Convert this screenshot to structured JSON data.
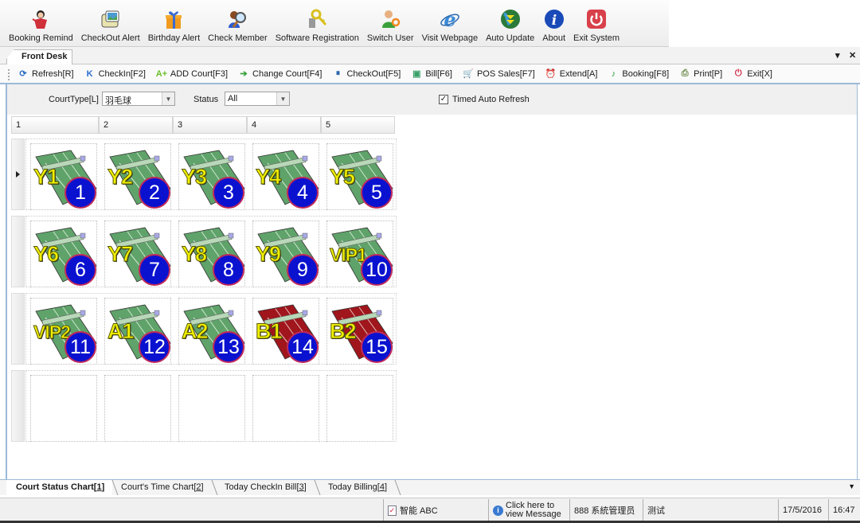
{
  "topbar": [
    {
      "label": "Booking Remind",
      "icon": "booking-remind-icon"
    },
    {
      "label": "CheckOut Alert",
      "icon": "checkout-alert-icon"
    },
    {
      "label": "Birthday Alert",
      "icon": "gift-icon"
    },
    {
      "label": "Check Member",
      "icon": "member-search-icon"
    },
    {
      "label": "Software Registration",
      "icon": "keys-icon"
    },
    {
      "label": "Switch User",
      "icon": "switch-user-icon"
    },
    {
      "label": "Visit Webpage",
      "icon": "browser-icon"
    },
    {
      "label": "Auto Update",
      "icon": "update-globe-icon"
    },
    {
      "label": "About",
      "icon": "info-icon"
    },
    {
      "label": "Exit System",
      "icon": "power-icon"
    }
  ],
  "doc_tab": {
    "label": "Front Desk"
  },
  "toolbar": [
    {
      "label": "Refresh[R]",
      "icon": "refresh-icon",
      "color": "#2b6cc4",
      "glyph": "⟳"
    },
    {
      "label": "CheckIn[F2]",
      "icon": "checkin-icon",
      "color": "#2a6fd0",
      "glyph": "K"
    },
    {
      "label": "ADD Court[F3]",
      "icon": "add-court-icon",
      "color": "#6cbf2a",
      "glyph": "A+"
    },
    {
      "label": "Change Court[F4]",
      "icon": "change-court-icon",
      "color": "#3aa23a",
      "glyph": "➔"
    },
    {
      "label": "CheckOut[F5]",
      "icon": "checkout-icon",
      "color": "#1d5fa8",
      "glyph": "⏸"
    },
    {
      "label": "Bill[F6]",
      "icon": "bill-icon",
      "color": "#3aa06a",
      "glyph": "▣"
    },
    {
      "label": "POS Sales[F7]",
      "icon": "cart-icon",
      "color": "#e05a8a",
      "glyph": "🛒"
    },
    {
      "label": "Extend[A]",
      "icon": "alarm-clock-icon",
      "color": "#222",
      "glyph": "⏰"
    },
    {
      "label": "Booking[F8]",
      "icon": "booking-icon",
      "color": "#2a9a3a",
      "glyph": "♪"
    },
    {
      "label": "Print[P]",
      "icon": "print-icon",
      "color": "#6a8a4a",
      "glyph": "⎙"
    },
    {
      "label": "Exit[X]",
      "icon": "exit-icon",
      "color": "#d0304a",
      "glyph": "⏻"
    }
  ],
  "filters": {
    "court_type_label": "CourtType[L]",
    "court_type_value": "羽毛球",
    "status_label": "Status",
    "status_value": "All",
    "auto_refresh_label": "Timed Auto Refresh",
    "auto_refresh_checked": true
  },
  "grid": {
    "columns": [
      "1",
      "2",
      "3",
      "4",
      "5"
    ],
    "rows": [
      [
        {
          "name": "Y1",
          "num": "1",
          "type": "green"
        },
        {
          "name": "Y2",
          "num": "2",
          "type": "green"
        },
        {
          "name": "Y3",
          "num": "3",
          "type": "green"
        },
        {
          "name": "Y4",
          "num": "4",
          "type": "green"
        },
        {
          "name": "Y5",
          "num": "5",
          "type": "green"
        }
      ],
      [
        {
          "name": "Y6",
          "num": "6",
          "type": "green"
        },
        {
          "name": "Y7",
          "num": "7",
          "type": "green"
        },
        {
          "name": "Y8",
          "num": "8",
          "type": "green"
        },
        {
          "name": "Y9",
          "num": "9",
          "type": "green"
        },
        {
          "name": "VIP1",
          "num": "10",
          "type": "green"
        }
      ],
      [
        {
          "name": "VIP2",
          "num": "11",
          "type": "green"
        },
        {
          "name": "A1",
          "num": "12",
          "type": "green"
        },
        {
          "name": "A2",
          "num": "13",
          "type": "green"
        },
        {
          "name": "B1",
          "num": "14",
          "type": "red"
        },
        {
          "name": "B2",
          "num": "15",
          "type": "red"
        }
      ],
      [
        null,
        null,
        null,
        null,
        null
      ]
    ]
  },
  "bottom_tabs": [
    {
      "label": "Court Status Chart",
      "key": "1",
      "active": true
    },
    {
      "label": "Court's Time Chart",
      "key": "2",
      "active": false
    },
    {
      "label": "Today CheckIn Bill",
      "key": "3",
      "active": false
    },
    {
      "label": "Today Billing",
      "key": "4",
      "active": false
    }
  ],
  "status": {
    "ime": "智能 ABC",
    "message": "Click here to view Message",
    "user": "888 系統管理员",
    "note": "测试",
    "date": "17/5/2016",
    "time": "16:47"
  },
  "colors": {
    "court_green": "#5fa36a",
    "court_red": "#a0161c",
    "badge_blue": "#0a12d0",
    "label_yellow": "#f1f000",
    "accent_blue": "#9cb9d8"
  }
}
